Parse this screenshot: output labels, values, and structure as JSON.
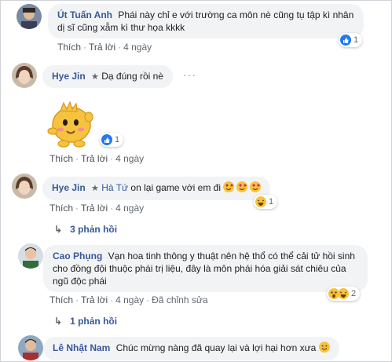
{
  "comments": [
    {
      "name": "Út Tuấn Anh",
      "text": "Phái này chỉ e với trường ca môn nè cũng tụ tập kì nhân dị sĩ cũng xẫm kì thư họa kkkk",
      "like_label": "Thích",
      "reply_label": "Trả lời",
      "time": "4 ngày",
      "reaction_count": "1"
    },
    {
      "name": "Hye Jin",
      "text": "Dạ đúng rồi nè",
      "sticker": "yellow-mascot-sticker",
      "like_label": "Thích",
      "reply_label": "Trả lời",
      "time": "4 ngày",
      "reaction_count": "1"
    },
    {
      "name": "Hye Jin",
      "tag": "Hà Tứ",
      "text": "on lại game với em đi",
      "like_label": "Thích",
      "reply_label": "Trả lời",
      "time": "4 ngày",
      "reaction_count": "1",
      "replies": "3 phản hồi"
    },
    {
      "name": "Cao Phụng",
      "text": "Vạn hoa tinh thông y thuật nên hệ thổ có thể cải tử hồi sinh cho đồng đội thuộc phái trị liệu, đây là môn phái hóa giải sát chiêu của ngũ độc phái",
      "like_label": "Thích",
      "reply_label": "Trả lời",
      "time": "4 ngày",
      "edited": "Đã chỉnh sửa",
      "reaction_count": "2",
      "replies": "1 phản hồi"
    },
    {
      "name": "Lê Nhật Nam",
      "text": "Chúc mừng nàng đã quay lại và lợi hại hơn xưa"
    }
  ],
  "colors": {
    "name": "#385898",
    "bubble": "#f2f3f5",
    "like": "#2078f4"
  }
}
